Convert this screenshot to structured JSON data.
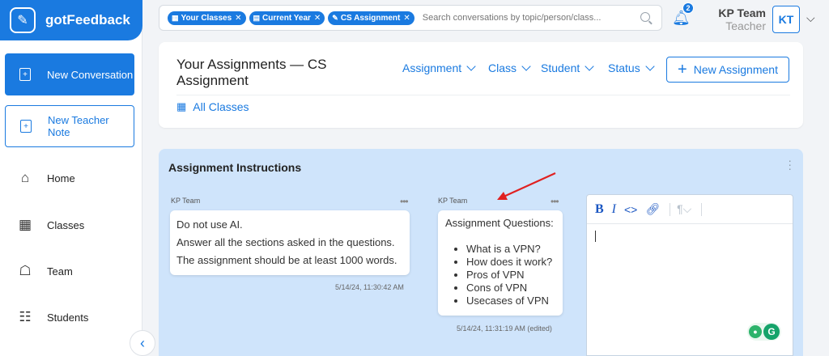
{
  "brand": {
    "name": "gotFeedback"
  },
  "sidebar": {
    "new_conversation": "New Conversation",
    "new_teacher_note": "New Teacher Note",
    "items": [
      {
        "label": "Home",
        "icon": "home-icon"
      },
      {
        "label": "Classes",
        "icon": "classes-icon"
      },
      {
        "label": "Team",
        "icon": "team-icon"
      },
      {
        "label": "Students",
        "icon": "students-icon"
      }
    ]
  },
  "search": {
    "chips": [
      {
        "label": "Your Classes"
      },
      {
        "label": "Current Year"
      },
      {
        "label": "CS Assignment"
      }
    ],
    "placeholder": "Search conversations by topic/person/class..."
  },
  "header": {
    "notification_count": "2",
    "user_name": "KP Team",
    "user_role": "Teacher",
    "user_initials": "KT"
  },
  "card": {
    "title": "Your Assignments — CS Assignment",
    "filters": [
      "Assignment",
      "Class",
      "Student",
      "Status"
    ],
    "new_assignment": "New Assignment",
    "all_classes": "All Classes"
  },
  "instructions": {
    "title": "Assignment Instructions",
    "messages": [
      {
        "author": "KP Team",
        "lines": [
          "Do not use AI.",
          "Answer all the sections asked in the questions.",
          "The assignment should be at least 1000 words."
        ],
        "timestamp": "5/14/24, 11:30:42 AM"
      },
      {
        "author": "KP Team",
        "heading": "Assignment Questions:",
        "bullets": [
          "What is a VPN?",
          "How does it work?",
          "Pros of VPN",
          "Cons of VPN",
          "Usecases of VPN"
        ],
        "timestamp": "5/14/24, 11:31:19 AM (edited)"
      }
    ]
  },
  "colors": {
    "accent": "#1a7ae0",
    "panel_bg": "#cfe4fb",
    "annotation_arrow": "#e02020"
  }
}
